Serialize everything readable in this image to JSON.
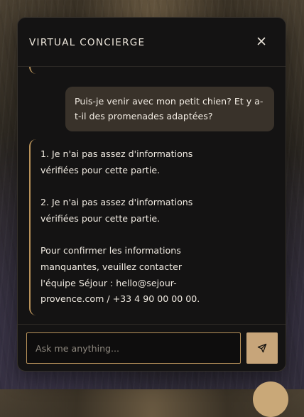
{
  "header": {
    "title": "VIRTUAL CONCIERGE",
    "close_icon": "close-icon"
  },
  "messages": {
    "user": "Puis-je venir avec mon petit chien? Et y a-t-il des promenades adaptées?",
    "bot": [
      "1. Je n'ai pas assez d'informations vérifiées pour cette partie.",
      "2. Je n'ai pas assez d'informations vérifiées pour cette partie.",
      "Pour confirmer les informations manquantes, veuillez contacter l'équipe Séjour : hello@sejour-provence.com / +33 4 90 00 00 00."
    ]
  },
  "composer": {
    "placeholder": "Ask me anything...",
    "value": "",
    "send_icon": "send-icon"
  },
  "colors": {
    "panel": "#141313",
    "accent": "#b8925a",
    "send_button": "#c7a57a",
    "user_bubble": "#39322a",
    "text": "#f1ebe2"
  }
}
